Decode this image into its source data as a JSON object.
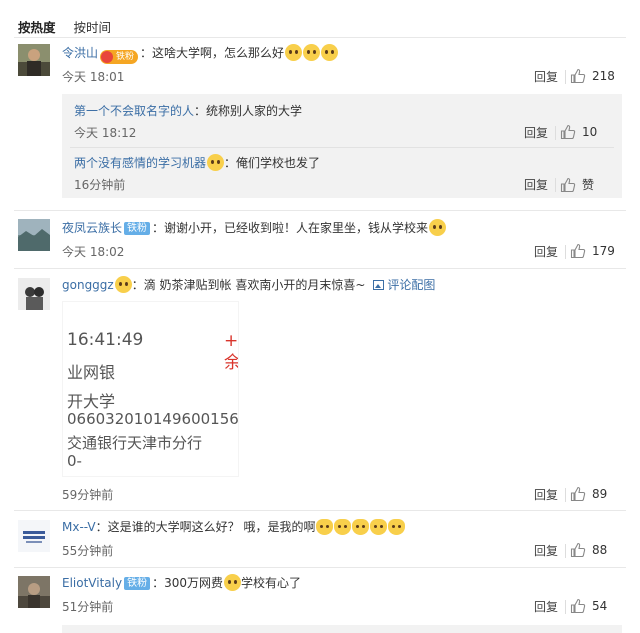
{
  "tabs": [
    "按热度",
    "按时间"
  ],
  "colors": {
    "link": "#3b6ea5",
    "badge_blue": "#65aee7",
    "fan_orange": "#f5a623",
    "reply_bg": "#f2f2f2"
  },
  "comments": [
    {
      "user": "令洪山",
      "badge": "铁粉",
      "text": "：这啥大学啊，怎么那么好",
      "emojis": [
        "sad-face",
        "sad-face",
        "sad-face"
      ],
      "time": "今天 18:01",
      "reply": "回复",
      "likes": "218",
      "replies": [
        {
          "user": "第一个不会取名字的人",
          "text": "：统称别人家的大学",
          "time": "今天 18:12",
          "reply": "回复",
          "likes": "10"
        },
        {
          "user": "两个没有感情的学习机器",
          "text": "：俺们学校也发了",
          "time": "16分钟前",
          "reply": "回复",
          "likes": "赞"
        }
      ]
    },
    {
      "user": "夜凤云族长",
      "badge": "铁粉",
      "text": "：谢谢小开，已经收到啦！人在家里坐，钱从学校来",
      "time": "今天 18:02",
      "reply": "回复",
      "likes": "179"
    },
    {
      "user": "gongggz",
      "text": "：滴 奶茶津贴到帐 喜欢南小开的月末惊喜~",
      "pic_link": "评论配图",
      "receipt": [
        "16:41:49",
        "业网银",
        "开大学",
        "066032010149600156",
        "交通银行天津市分行",
        "0-"
      ],
      "receipt_mark": "+ 余",
      "time": "59分钟前",
      "reply": "回复",
      "likes": "89"
    },
    {
      "user": "Mx--V",
      "text": "：这是谁的大学啊这么好？ 哦，是我的啊",
      "emojis": [
        "cat-face",
        "cat-face",
        "cat-face",
        "cat-face",
        "cat-face"
      ],
      "time": "55分钟前",
      "reply": "回复",
      "likes": "88"
    },
    {
      "user": "EliotVitaly",
      "badge": "铁粉",
      "text": "：300万网费",
      "text_after": "学校有心了",
      "time": "51分钟前",
      "reply": "回复",
      "likes": "54"
    }
  ]
}
